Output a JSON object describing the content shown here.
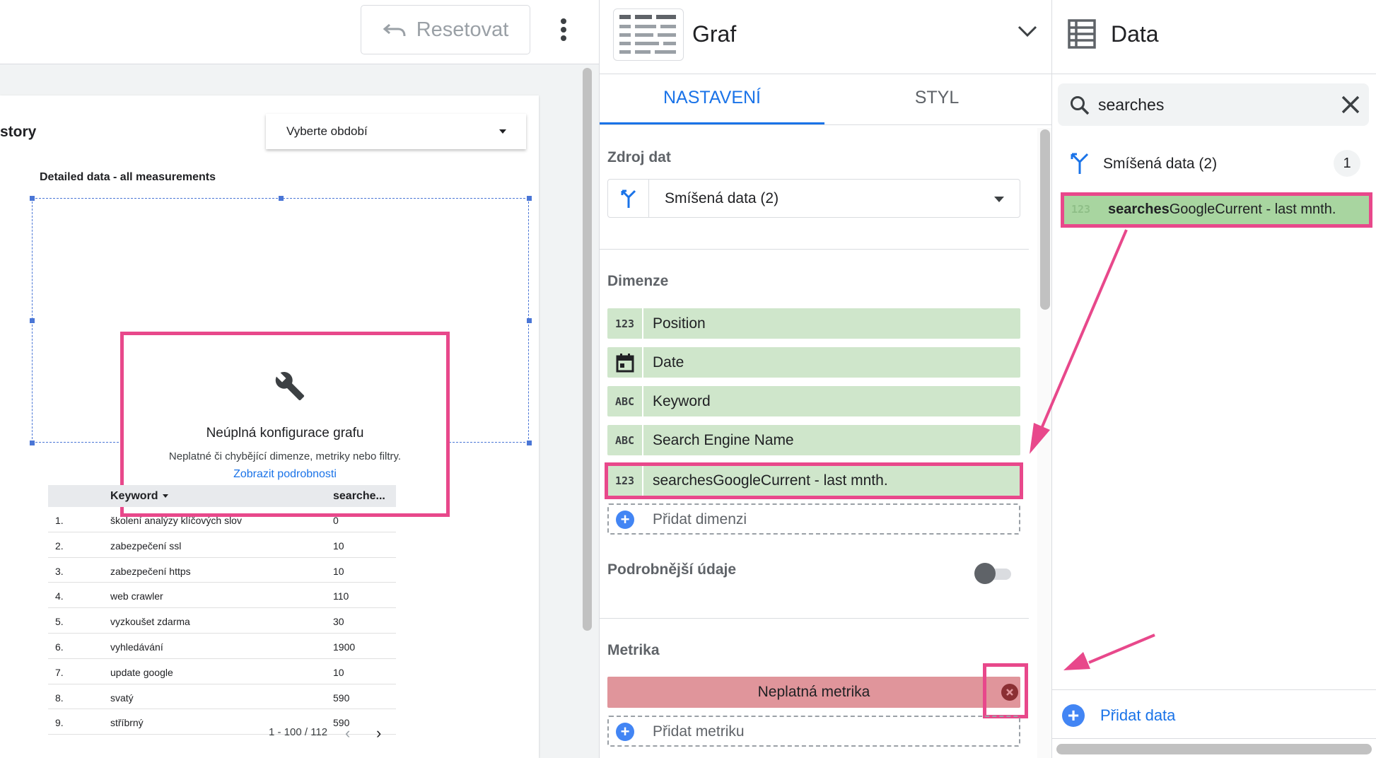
{
  "toolbar": {
    "reset_label": "Resetovat"
  },
  "report": {
    "title": "story",
    "period_placeholder": "Vyberte období",
    "chart_title": "Detailed data - all measurements",
    "error": {
      "title": "Neúplná konfigurace grafu",
      "description": "Neplatné či chybějící dimenze, metriky nebo filtry.",
      "link": "Zobrazit podrobnosti"
    },
    "table": {
      "headers": [
        "Keyword",
        "searche..."
      ],
      "rows": [
        {
          "num": "1.",
          "keyword": "školení analýzy klíčových slov",
          "value": "0"
        },
        {
          "num": "2.",
          "keyword": "zabezpečení ssl",
          "value": "10"
        },
        {
          "num": "3.",
          "keyword": "zabezpečení https",
          "value": "10"
        },
        {
          "num": "4.",
          "keyword": "web crawler",
          "value": "110"
        },
        {
          "num": "5.",
          "keyword": "vyzkoušet zdarma",
          "value": "30"
        },
        {
          "num": "6.",
          "keyword": "vyhledávání",
          "value": "1900"
        },
        {
          "num": "7.",
          "keyword": "update google",
          "value": "10"
        },
        {
          "num": "8.",
          "keyword": "svatý",
          "value": "590"
        },
        {
          "num": "9.",
          "keyword": "stříbrný",
          "value": "590"
        }
      ],
      "pager": "1 - 100 / 112"
    }
  },
  "properties": {
    "chart_type": "Graf",
    "tabs": {
      "setup": "NASTAVENÍ",
      "style": "STYL"
    },
    "data_source": {
      "label": "Zdroj dat",
      "value": "Smíšená data (2)"
    },
    "dimensions": {
      "label": "Dimenze",
      "items": [
        {
          "type": "123",
          "name": "Position"
        },
        {
          "type": "date",
          "name": "Date"
        },
        {
          "type": "ABC",
          "name": "Keyword"
        },
        {
          "type": "ABC",
          "name": "Search Engine Name"
        },
        {
          "type": "123",
          "name": "searchesGoogleCurrent - last mnth."
        }
      ],
      "add_label": "Přidat dimenzi"
    },
    "drill_down": {
      "label": "Podrobnější údaje"
    },
    "metrics": {
      "label": "Metrika",
      "invalid_label": "Neplatná metrika",
      "add_label": "Přidat metriku"
    }
  },
  "data_panel": {
    "title": "Data",
    "search_value": "searches",
    "source": {
      "name": "Smíšená data (2)",
      "count": "1"
    },
    "field": {
      "type": "123",
      "match": "searches",
      "rest": "GoogleCurrent - last mnth."
    },
    "add_data_label": "Přidat data"
  },
  "colors": {
    "highlight": "#e8488b",
    "accent": "#1a73e8",
    "chip_green": "#cfe6cb",
    "invalid_red": "#e0959b"
  }
}
